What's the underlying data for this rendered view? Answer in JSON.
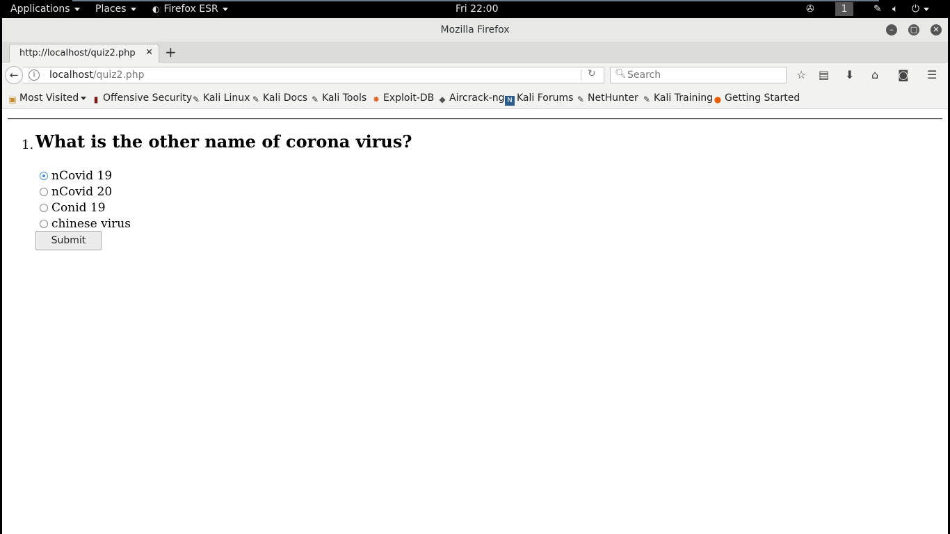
{
  "topbar": {
    "applications": "Applications",
    "places": "Places",
    "app_name": "Firefox ESR",
    "clock": "Fri 22:00",
    "workspace": "1"
  },
  "window": {
    "title": "Mozilla Firefox"
  },
  "tabs": [
    {
      "label": "http://localhost/quiz2.php",
      "active": true
    }
  ],
  "navbar": {
    "url_host": "localhost",
    "url_path": "/quiz2.php",
    "search_placeholder": "Search"
  },
  "bookmarks": [
    {
      "label": "Most Visited",
      "icon": "folder-icon"
    },
    {
      "label": "Offensive Security",
      "icon": "offsec-icon"
    },
    {
      "label": "Kali Linux",
      "icon": "kali-icon"
    },
    {
      "label": "Kali Docs",
      "icon": "kali-icon"
    },
    {
      "label": "Kali Tools",
      "icon": "kali-icon"
    },
    {
      "label": "Exploit-DB",
      "icon": "exploitdb-icon"
    },
    {
      "label": "Aircrack-ng",
      "icon": "aircrack-icon"
    },
    {
      "label": "Kali Forums",
      "icon": "forums-icon"
    },
    {
      "label": "NetHunter",
      "icon": "kali-icon"
    },
    {
      "label": "Kali Training",
      "icon": "kali-icon"
    },
    {
      "label": "Getting Started",
      "icon": "firefox-icon"
    }
  ],
  "quiz": {
    "number": "1.",
    "question": "What is the other name of corona virus?",
    "options": [
      {
        "label": "nCovid 19",
        "checked": true
      },
      {
        "label": "nCovid 20",
        "checked": false
      },
      {
        "label": "Conid 19",
        "checked": false
      },
      {
        "label": "chinese virus",
        "checked": false
      }
    ],
    "submit_label": "Submit"
  },
  "colors": {
    "radio_accent": "#4a8ac9",
    "topbar_bg": "#000000",
    "chrome_bg": "#f2f2f1"
  }
}
